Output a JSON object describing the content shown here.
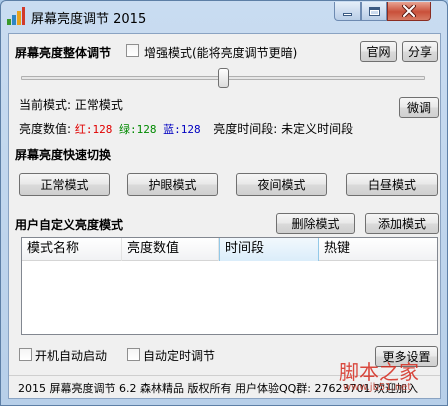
{
  "window": {
    "title": "屏幕亮度调节 2015"
  },
  "overall": {
    "heading": "屏幕亮度整体调节",
    "enhance_label": "增强模式(能将亮度调节更暗)",
    "enhance_checked": false,
    "website_button": "官网",
    "share_button": "分享",
    "slider_level": 0.5
  },
  "status_info": {
    "current_mode_label": "当前模式:",
    "current_mode_value": "正常模式",
    "fine_tune_button": "微调",
    "brightness_label": "亮度数值:",
    "red_label": "红:",
    "red_value": "128",
    "green_label": "绿:",
    "green_value": "128",
    "blue_label": "蓝:",
    "blue_value": "128",
    "period_label": "亮度时间段:",
    "period_value": "未定义时间段"
  },
  "quick_switch": {
    "heading": "屏幕亮度快速切换",
    "buttons": [
      "正常模式",
      "护眼模式",
      "夜间模式",
      "白昼模式"
    ]
  },
  "custom": {
    "heading": "用户自定义亮度模式",
    "delete_button": "删除模式",
    "add_button": "添加模式",
    "columns": [
      "模式名称",
      "亮度数值",
      "时间段",
      "热键"
    ],
    "active_column": 2,
    "rows": []
  },
  "options": {
    "autostart_label": "开机自动启动",
    "autostart_checked": false,
    "auto_schedule_label": "自动定时调节",
    "auto_schedule_checked": false,
    "more_settings_button": "更多设置"
  },
  "footer": {
    "text": "2015 屏幕亮度调节 6.2 森林精品 版权所有 用户体验QQ群: 27623701 欢迎加入"
  },
  "watermark": {
    "line1": "脚本之家",
    "line2": "www.jb51.net"
  },
  "colors": {
    "red": "#e00000",
    "green": "#008a00",
    "blue": "#0000c0"
  }
}
